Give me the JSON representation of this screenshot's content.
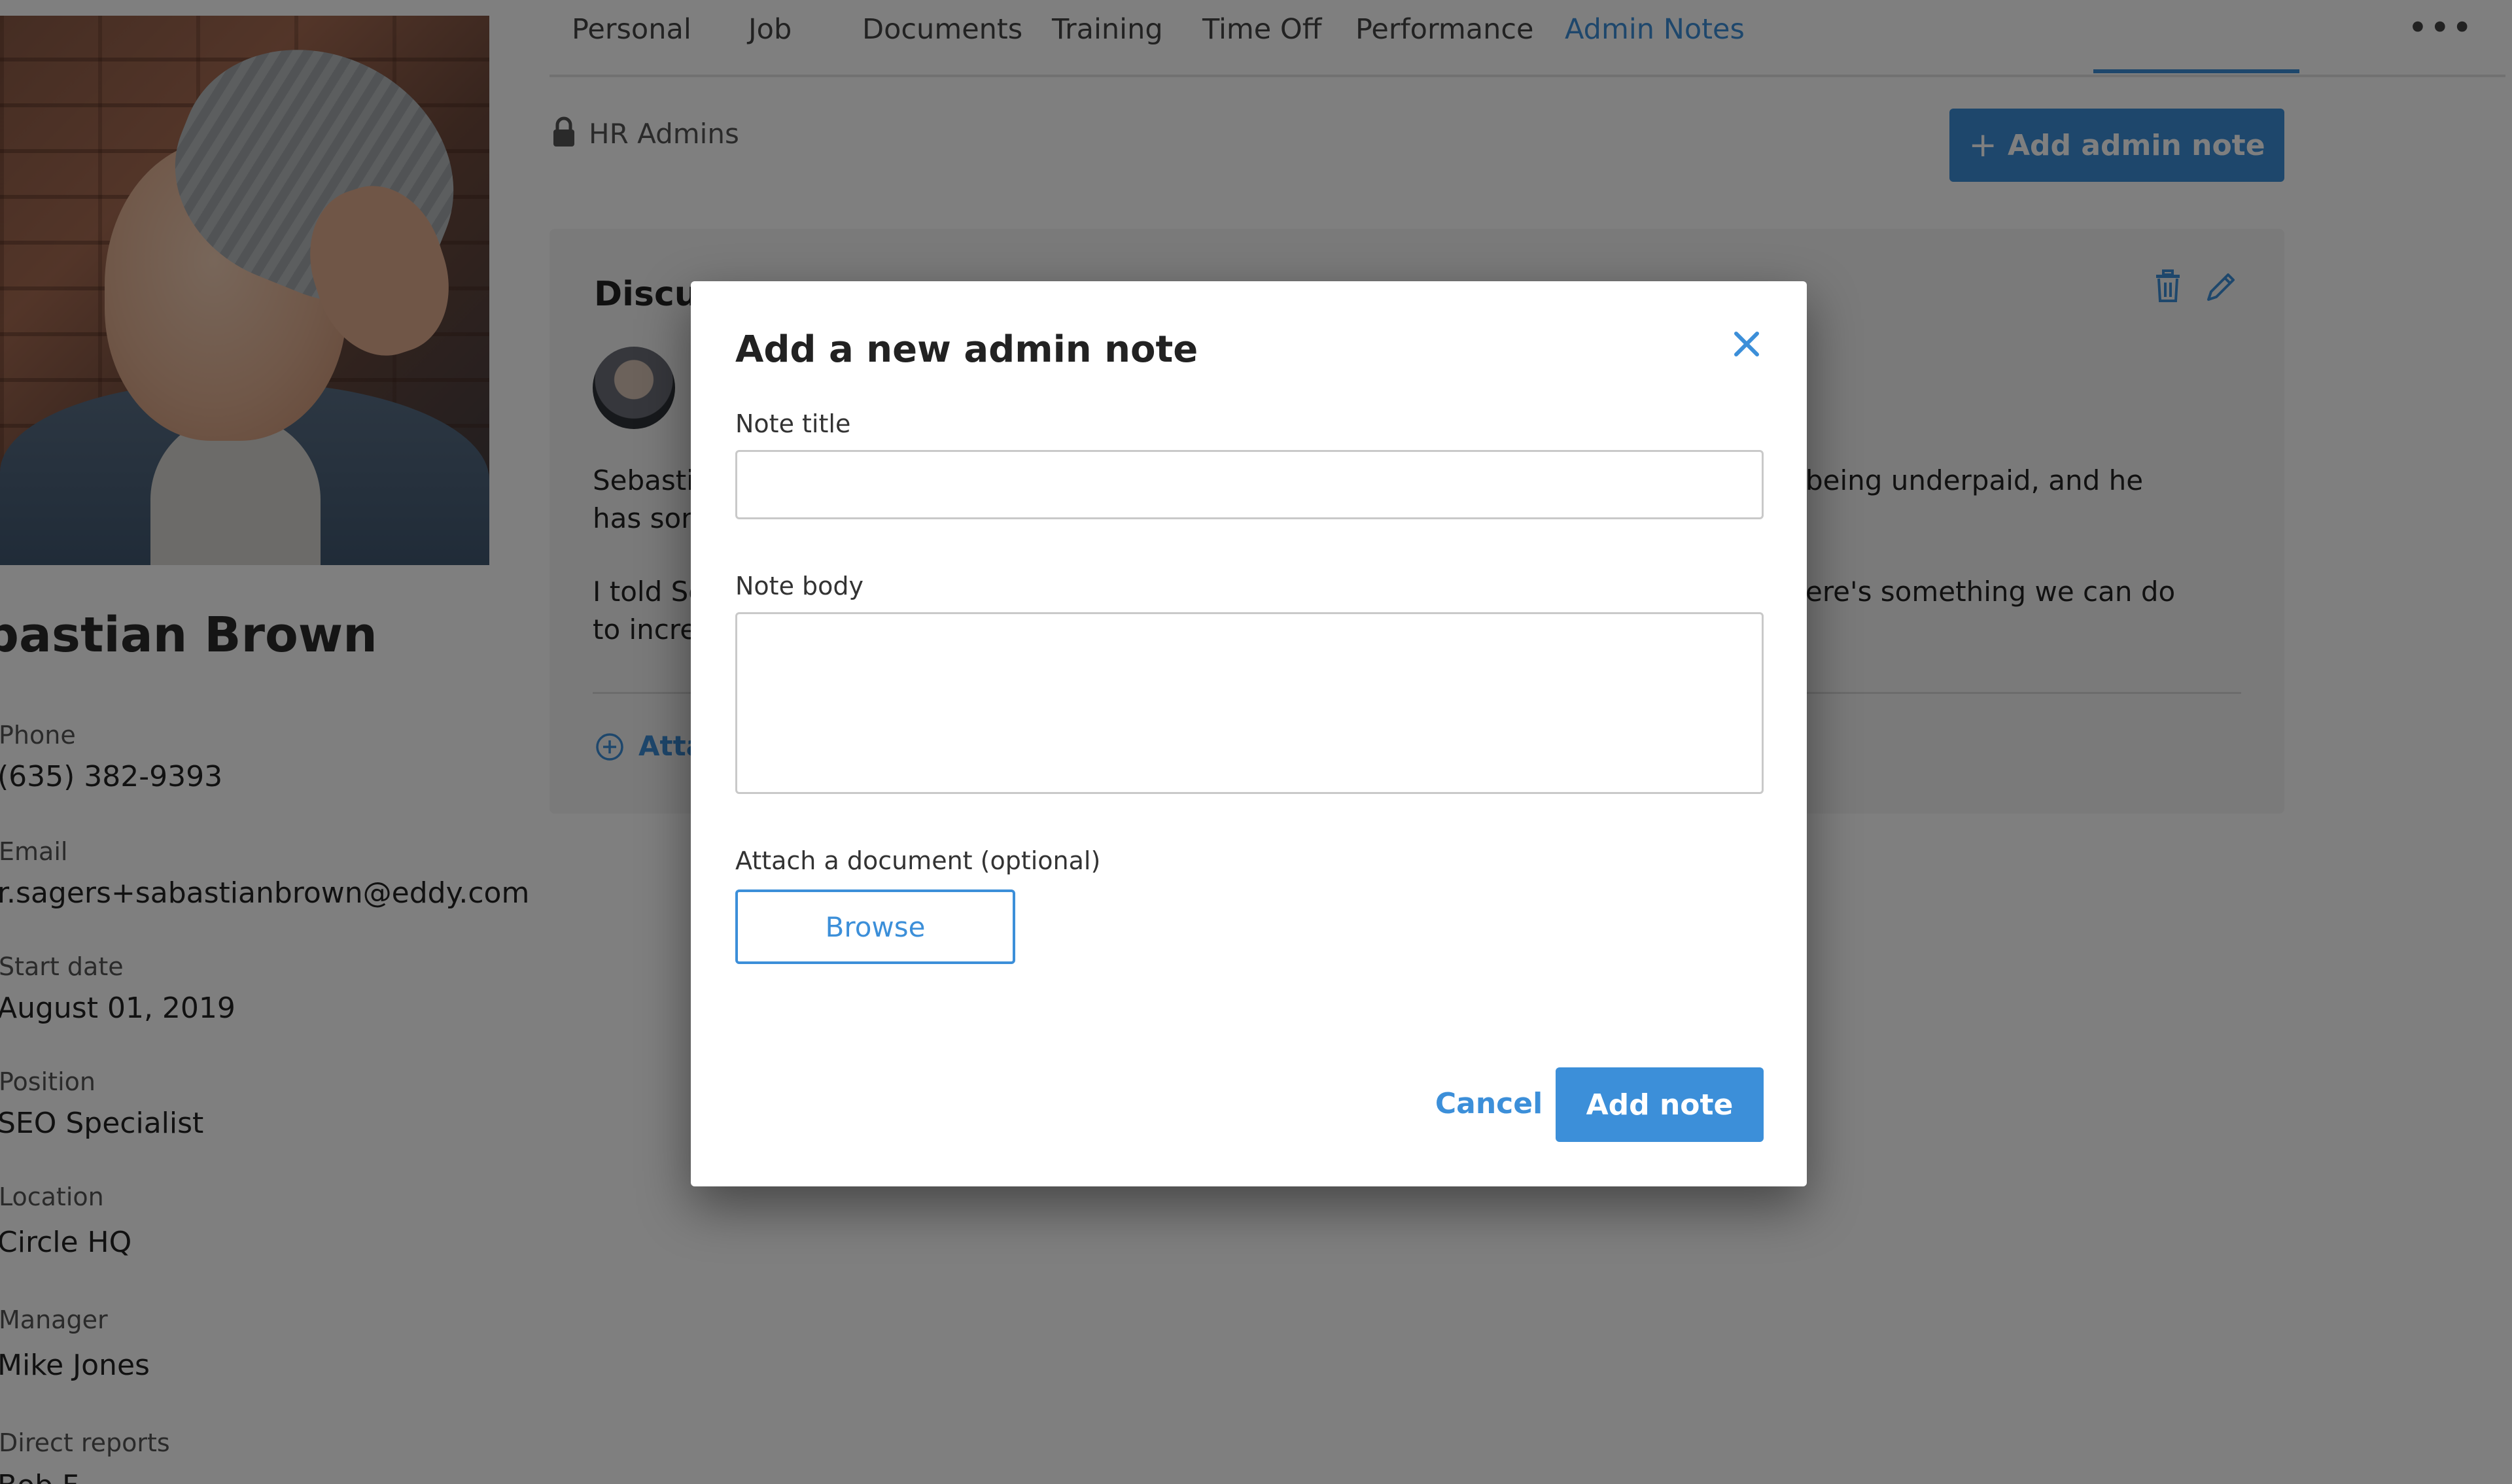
{
  "profile": {
    "name": "bastian Brown",
    "fields": [
      {
        "label": "Phone",
        "value": "(635) 382-9393"
      },
      {
        "label": "Email",
        "value": "r.sagers+sabastianbrown@eddy.com"
      },
      {
        "label": "Start date",
        "value": "August 01, 2019"
      },
      {
        "label": "Position",
        "value": "SEO Specialist"
      },
      {
        "label": "Location",
        "value": "Circle HQ"
      },
      {
        "label": "Manager",
        "value": "Mike Jones"
      },
      {
        "label": "Direct reports",
        "value": "Bob F..."
      }
    ]
  },
  "tabs": [
    {
      "label": "Personal"
    },
    {
      "label": "Job"
    },
    {
      "label": "Documents"
    },
    {
      "label": "Training"
    },
    {
      "label": "Time Off"
    },
    {
      "label": "Performance"
    },
    {
      "label": "Admin Notes",
      "active": true
    }
  ],
  "tabs_more": "•••",
  "main": {
    "visibility_label": "HR Admins",
    "add_admin_note_label": "Add admin note",
    "add_admin_note_plus": "+",
    "note": {
      "title": "Discus",
      "line1_left": "Sebasti",
      "line1_right": "being underpaid, and he",
      "line2_left": "has som",
      "line3_left": "I told Se",
      "line3_right": "ere's something we can do",
      "line4_left": "to incre",
      "attach_label": "Atta"
    }
  },
  "modal": {
    "title": "Add a new admin note",
    "note_title_label": "Note title",
    "note_title_value": "",
    "note_body_label": "Note body",
    "note_body_value": "",
    "attach_label": "Attach a document (optional)",
    "browse_label": "Browse",
    "cancel_label": "Cancel",
    "submit_label": "Add note"
  },
  "colors": {
    "accent": "#3c8fd9",
    "overlay": "rgba(0,0,0,0.5)"
  }
}
